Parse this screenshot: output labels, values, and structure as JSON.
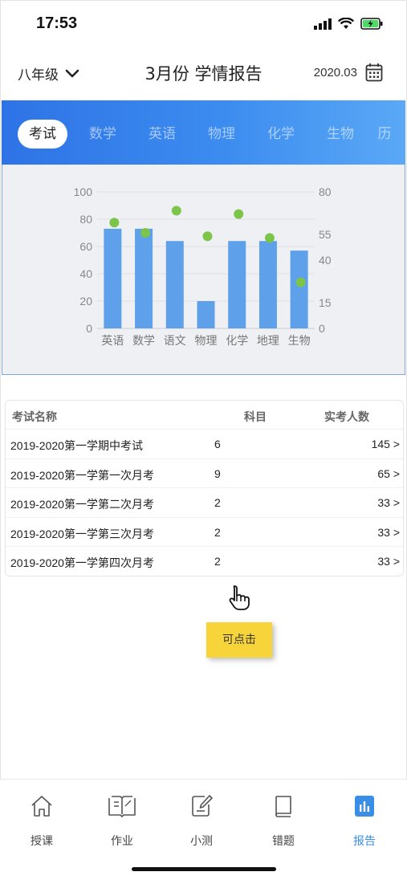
{
  "status_bar": {
    "time": "17:53"
  },
  "header": {
    "grade_label": "八年级",
    "title": "3月份 学情报告",
    "date_label": "2020.03"
  },
  "tabs": [
    {
      "label": "考试",
      "active": true
    },
    {
      "label": "数学",
      "active": false
    },
    {
      "label": "英语",
      "active": false
    },
    {
      "label": "物理",
      "active": false
    },
    {
      "label": "化学",
      "active": false
    },
    {
      "label": "生物",
      "active": false
    },
    {
      "label": "历",
      "active": false
    }
  ],
  "chart_data": {
    "type": "bar",
    "categories": [
      "英语",
      "数学",
      "语文",
      "物理",
      "化学",
      "地理",
      "生物"
    ],
    "series": [
      {
        "type": "bar",
        "axis": "left",
        "values": [
          73,
          73,
          64,
          20,
          64,
          64,
          57
        ],
        "color": "#5ea0ea"
      },
      {
        "type": "scatter",
        "axis": "right",
        "values": [
          62,
          56,
          69,
          54,
          67,
          53,
          27
        ],
        "color": "#7dc44a"
      }
    ],
    "y_left": {
      "ticks": [
        0,
        20,
        40,
        60,
        80,
        100
      ],
      "ylim": [
        0,
        100
      ]
    },
    "y_right": {
      "ticks": [
        0,
        15,
        40,
        55,
        80
      ],
      "ylim": [
        0,
        80
      ]
    },
    "grid": true
  },
  "table": {
    "headers": {
      "name": "考试名称",
      "subjects": "科目",
      "count": "实考人数"
    },
    "rows": [
      {
        "name": "2019-2020第一学期中考试",
        "subjects": "6",
        "count": "145 >"
      },
      {
        "name": "2019-2020第一学第一次月考",
        "subjects": "9",
        "count": "65 >"
      },
      {
        "name": "2019-2020第一学第二次月考",
        "subjects": "2",
        "count": "33 >"
      },
      {
        "name": "2019-2020第一学第三次月考",
        "subjects": "2",
        "count": "33 >"
      },
      {
        "name": "2019-2020第一学第四次月考",
        "subjects": "2",
        "count": "33 >"
      }
    ]
  },
  "tooltip": {
    "label": "可点击"
  },
  "bottom_nav": [
    {
      "label": "授课",
      "icon": "home-icon",
      "active": false
    },
    {
      "label": "作业",
      "icon": "open-book-icon",
      "active": false
    },
    {
      "label": "小测",
      "icon": "edit-note-icon",
      "active": false
    },
    {
      "label": "错题",
      "icon": "book-icon",
      "active": false
    },
    {
      "label": "报告",
      "icon": "report-chart-icon",
      "active": true
    }
  ],
  "colors": {
    "accent": "#3a8ee6",
    "bar": "#5ea0ea",
    "dot": "#7dc44a",
    "tooltip": "#f7d43a"
  }
}
